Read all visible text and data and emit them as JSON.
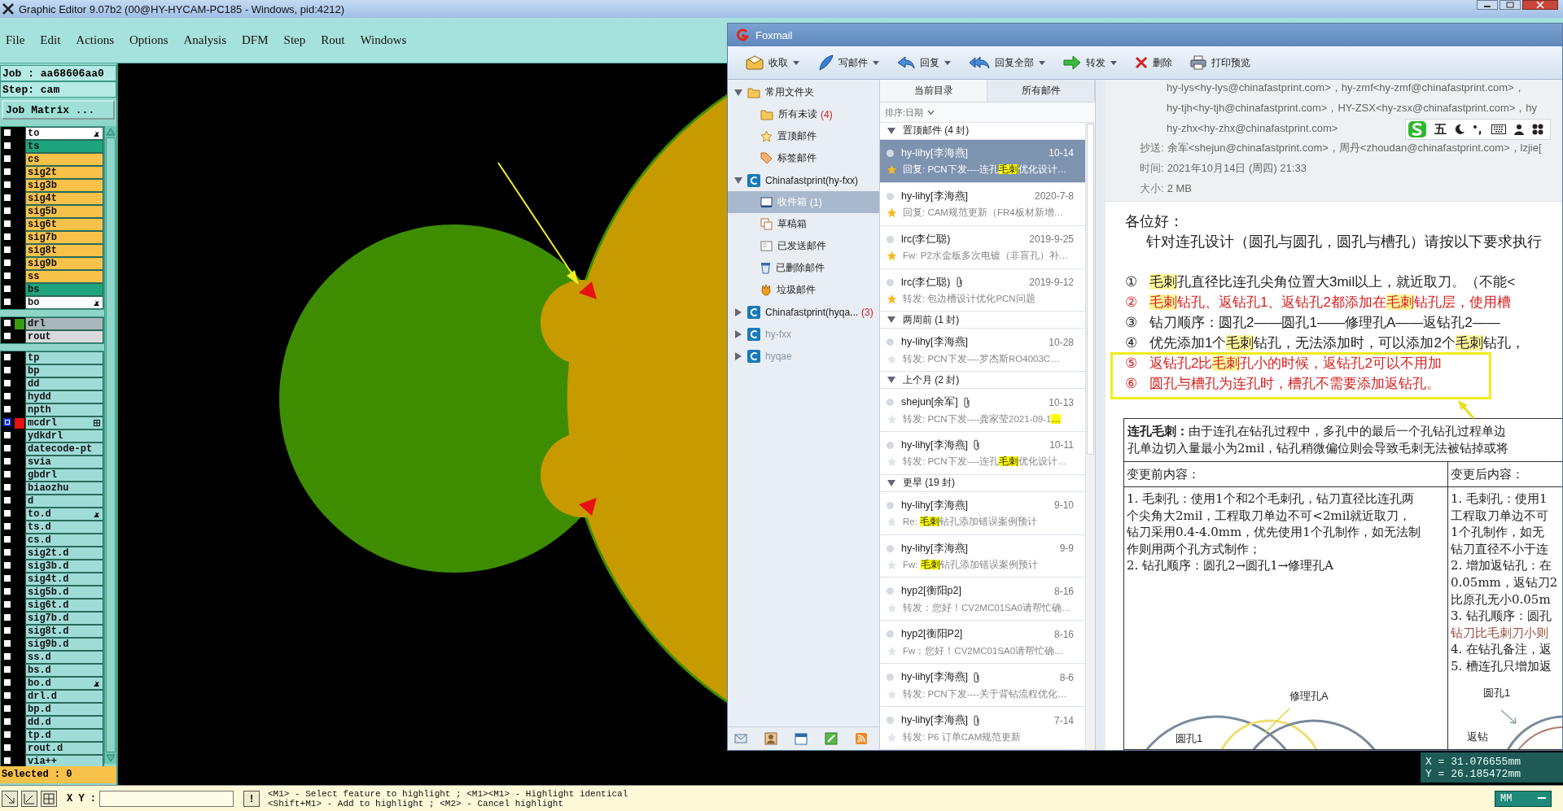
{
  "editor": {
    "title": "Graphic Editor 9.07b2 (00@HY-HYCAM-PC185 - Windows, pid:4212)",
    "menu": [
      "File",
      "Edit",
      "Actions",
      "Options",
      "Analysis",
      "DFM",
      "Step",
      "Rout",
      "Windows"
    ],
    "job": "Job : aa68606aa0",
    "step": "Step: cam",
    "job_matrix_button": "Job Matrix ...",
    "layer_groups": [
      [
        {
          "name": "to",
          "color": "#ffffff",
          "marker": {
            "kind": "hand"
          },
          "selected": false
        },
        {
          "name": "ts",
          "color": "#1fa37c",
          "selected": false
        },
        {
          "name": "cs",
          "color": "#f8c24a",
          "selected": false
        },
        {
          "name": "sig2t",
          "color": "#f8c24a",
          "selected": false
        },
        {
          "name": "sig3b",
          "color": "#f8c24a",
          "selected": false
        },
        {
          "name": "sig4t",
          "color": "#f8c24a",
          "selected": false
        },
        {
          "name": "sig5b",
          "color": "#f8c24a",
          "selected": false
        },
        {
          "name": "sig6t",
          "color": "#f8c24a",
          "selected": false
        },
        {
          "name": "sig7b",
          "color": "#f8c24a",
          "selected": false
        },
        {
          "name": "sig8t",
          "color": "#f8c24a",
          "selected": false
        },
        {
          "name": "sig9b",
          "color": "#f8c24a",
          "selected": false
        },
        {
          "name": "ss",
          "color": "#f8c24a",
          "selected": false
        },
        {
          "name": "bs",
          "color": "#1fa37c",
          "selected": false
        },
        {
          "name": "bo",
          "color": "#ffffff",
          "marker": {
            "kind": "hand"
          },
          "selected": false
        }
      ],
      [
        {
          "name": "drl",
          "color": "#a9b6ba",
          "swatch": {
            "color": "#3c9a10"
          },
          "selected": false
        },
        {
          "name": "rout",
          "color": "#dadada",
          "selected": false
        }
      ],
      [
        {
          "name": "tp",
          "color": "#9fdcd8",
          "selected": false
        },
        {
          "name": "bp",
          "color": "#9fdcd8",
          "selected": false
        },
        {
          "name": "dd",
          "color": "#9fdcd8",
          "selected": false
        },
        {
          "name": "hydd",
          "color": "#9fdcd8",
          "selected": false
        },
        {
          "name": "npth",
          "color": "#9fdcd8",
          "selected": false
        },
        {
          "name": "mcdrl",
          "color": "#9fdcd8",
          "swatch": {
            "color": "#e81010"
          },
          "marker": {
            "kind": "grid"
          },
          "selected": true
        },
        {
          "name": "ydkdrl",
          "color": "#9fdcd8",
          "selected": false
        },
        {
          "name": "datecode-pt",
          "color": "#9fdcd8",
          "selected": false
        },
        {
          "name": "svia",
          "color": "#9fdcd8",
          "selected": false
        },
        {
          "name": "gbdrl",
          "color": "#9fdcd8",
          "selected": false
        },
        {
          "name": "biaozhu",
          "color": "#9fdcd8",
          "selected": false
        },
        {
          "name": "d",
          "color": "#9fdcd8",
          "selected": false
        },
        {
          "name": "to.d",
          "color": "#9fdcd8",
          "marker": {
            "kind": "hand"
          },
          "selected": false
        },
        {
          "name": "ts.d",
          "color": "#9fdcd8",
          "selected": false
        },
        {
          "name": "cs.d",
          "color": "#9fdcd8",
          "selected": false
        },
        {
          "name": "sig2t.d",
          "color": "#9fdcd8",
          "selected": false
        },
        {
          "name": "sig3b.d",
          "color": "#9fdcd8",
          "selected": false
        },
        {
          "name": "sig4t.d",
          "color": "#9fdcd8",
          "selected": false
        },
        {
          "name": "sig5b.d",
          "color": "#9fdcd8",
          "selected": false
        },
        {
          "name": "sig6t.d",
          "color": "#9fdcd8",
          "selected": false
        },
        {
          "name": "sig7b.d",
          "color": "#9fdcd8",
          "selected": false
        },
        {
          "name": "sig8t.d",
          "color": "#9fdcd8",
          "selected": false
        },
        {
          "name": "sig9b.d",
          "color": "#9fdcd8",
          "selected": false
        },
        {
          "name": "ss.d",
          "color": "#9fdcd8",
          "selected": false
        },
        {
          "name": "bs.d",
          "color": "#9fdcd8",
          "selected": false
        },
        {
          "name": "bo.d",
          "color": "#9fdcd8",
          "marker": {
            "kind": "hand"
          },
          "selected": false
        },
        {
          "name": "drl.d",
          "color": "#9fdcd8",
          "selected": false
        },
        {
          "name": "bp.d",
          "color": "#9fdcd8",
          "selected": false
        },
        {
          "name": "dd.d",
          "color": "#9fdcd8",
          "selected": false
        },
        {
          "name": "tp.d",
          "color": "#9fdcd8",
          "selected": false
        },
        {
          "name": "rout.d",
          "color": "#9fdcd8",
          "selected": false
        },
        {
          "name": "via++",
          "color": "#9fdcd8",
          "selected": false
        }
      ]
    ],
    "selected_count": "Selected : 0",
    "coordinates": [
      "X = 31.076655mm",
      "Y = 26.185472mm"
    ],
    "xy_label": "X Y :",
    "exclaim_button": "!",
    "hint_lines": [
      "<M1> - Select feature to highlight ; <M1><M1> - Highlight identical",
      "<Shift+M1> - Add to highlight ; <M2> - Cancel highlight"
    ],
    "units": "MM"
  },
  "foxmail": {
    "title": "Foxmail",
    "toolbar": [
      {
        "label": "收取",
        "kind": "receive",
        "dropdown": true
      },
      {
        "label": "写邮件",
        "kind": "compose",
        "dropdown": true
      },
      {
        "label": "回复",
        "kind": "reply",
        "dropdown": true
      },
      {
        "label": "回复全部",
        "kind": "reply_all",
        "dropdown": true
      },
      {
        "label": "转发",
        "kind": "forward",
        "dropdown": true
      },
      {
        "label": "删除",
        "kind": "delete",
        "dropdown": false
      },
      {
        "label": "打印预览",
        "kind": "print",
        "dropdown": false
      }
    ],
    "folders": [
      {
        "label": "常用文件夹",
        "kind": "folder",
        "expanded": true,
        "selected": false,
        "disabled": false,
        "children": [
          {
            "label": "所有未读",
            "kind": "folder",
            "count": "(4)",
            "selected": false,
            "disabled": false
          },
          {
            "label": "置顶邮件",
            "kind": "star",
            "selected": false,
            "disabled": false
          },
          {
            "label": "标签邮件",
            "kind": "tag",
            "selected": false,
            "disabled": false
          }
        ]
      },
      {
        "label": "Chinafastprint(hy-fxx)",
        "kind": "account",
        "expanded": true,
        "selected": false,
        "disabled": false,
        "children": [
          {
            "label": "收件箱",
            "kind": "inbox",
            "count": "(1)",
            "selected": true,
            "disabled": false
          },
          {
            "label": "草稿箱",
            "kind": "drafts",
            "selected": false,
            "disabled": false
          },
          {
            "label": "已发送邮件",
            "kind": "sent",
            "selected": false,
            "disabled": false
          },
          {
            "label": "已删除邮件",
            "kind": "deleted",
            "selected": false,
            "disabled": false
          },
          {
            "label": "垃圾邮件",
            "kind": "junk",
            "selected": false,
            "disabled": false
          }
        ]
      },
      {
        "label": "Chinafastprint(hyqa...",
        "kind": "account",
        "count": "(3)",
        "expanded": false,
        "selected": false,
        "disabled": false
      },
      {
        "label": "hy-fxx",
        "kind": "account",
        "expanded": false,
        "selected": false,
        "disabled": true
      },
      {
        "label": "hyqae",
        "kind": "account",
        "expanded": false,
        "selected": false,
        "disabled": true
      }
    ],
    "list_tabs": [
      {
        "label": "当前目录",
        "selected": true
      },
      {
        "label": "所有邮件",
        "selected": false
      }
    ],
    "sort": "排序:日期",
    "mail_groups": [
      {
        "title": "置顶邮件 (4 封)",
        "expanded": true,
        "items": [
          {
            "sender": "hy-lihy[李海燕]",
            "date": "10-14",
            "attachment": false,
            "starred": true,
            "selected": true,
            "subject": [
              {
                "text": "回复: PCN下发----连孔",
                "highlight": false
              },
              {
                "text": "毛刺",
                "highlight": true
              },
              {
                "text": "优化设计…",
                "highlight": false
              }
            ]
          },
          {
            "sender": "hy-lihy[李海燕]",
            "date": "2020-7-8",
            "attachment": false,
            "starred": true,
            "selected": false,
            "subject": [
              {
                "text": "回复: CAM规范更新（FR4板材新增…",
                "highlight": false
              }
            ]
          },
          {
            "sender": "lrc(李仁聪)",
            "date": "2019-9-25",
            "attachment": false,
            "starred": true,
            "selected": false,
            "subject": [
              {
                "text": "Fw: P2水金板多次电镀（非盲孔）补…",
                "highlight": false
              }
            ]
          },
          {
            "sender": "lrc(李仁聪)",
            "date": "2019-9-12",
            "attachment": true,
            "starred": true,
            "selected": false,
            "subject": [
              {
                "text": "转发: 包边槽设计优化PCN问题",
                "highlight": false
              }
            ]
          }
        ]
      },
      {
        "title": "两周前 (1 封)",
        "expanded": true,
        "items": [
          {
            "sender": "hy-lihy[李海燕]",
            "date": "10-28",
            "attachment": false,
            "starred": false,
            "selected": false,
            "subject": [
              {
                "text": "转发: PCN下发----罗杰斯RO4003C…",
                "highlight": false
              }
            ]
          }
        ]
      },
      {
        "title": "上个月 (2 封)",
        "expanded": true,
        "items": [
          {
            "sender": "shejun[余军]",
            "date": "10-13",
            "attachment": true,
            "starred": false,
            "selected": false,
            "subject": [
              {
                "text": "转发: PCN下发----龚家莹2021-09-1",
                "highlight": false
              },
              {
                "text": "…",
                "highlight": true
              }
            ]
          },
          {
            "sender": "hy-lihy[李海燕]",
            "date": "10-11",
            "attachment": true,
            "starred": false,
            "selected": false,
            "subject": [
              {
                "text": "转发: PCN下发----连孔",
                "highlight": false
              },
              {
                "text": "毛刺",
                "highlight": true
              },
              {
                "text": "优化设计…",
                "highlight": false
              }
            ]
          }
        ]
      },
      {
        "title": "更早 (19 封)",
        "expanded": true,
        "items": [
          {
            "sender": "hy-lihy[李海燕]",
            "date": "9-10",
            "attachment": false,
            "starred": false,
            "selected": false,
            "subject": [
              {
                "text": "Re: ",
                "highlight": false
              },
              {
                "text": "毛刺",
                "highlight": true
              },
              {
                "text": "钻孔添加错误案例预计",
                "highlight": false
              }
            ]
          },
          {
            "sender": "hy-lihy[李海燕]",
            "date": "9-9",
            "attachment": false,
            "starred": false,
            "selected": false,
            "subject": [
              {
                "text": "Fw: ",
                "highlight": false
              },
              {
                "text": "毛刺",
                "highlight": true
              },
              {
                "text": "钻孔添加错误案例预计",
                "highlight": false
              }
            ]
          },
          {
            "sender": "hyp2[衡阳p2]",
            "date": "8-16",
            "attachment": false,
            "starred": false,
            "selected": false,
            "subject": [
              {
                "text": "转发：您好！CV2MC01SA0请帮忙确…",
                "highlight": false
              }
            ]
          },
          {
            "sender": "hyp2[衡阳P2]",
            "date": "8-16",
            "attachment": false,
            "starred": false,
            "selected": false,
            "subject": [
              {
                "text": "Fw：您好！CV2MC01SA0请帮忙确…",
                "highlight": false
              }
            ]
          },
          {
            "sender": "hy-lihy[李海燕]",
            "date": "8-6",
            "attachment": true,
            "starred": false,
            "selected": false,
            "subject": [
              {
                "text": "转发: PCN下发----关于背钻流程优化…",
                "highlight": false
              }
            ]
          },
          {
            "sender": "hy-lihy[李海燕]",
            "date": "7-14",
            "attachment": true,
            "starred": false,
            "selected": false,
            "subject": [
              {
                "text": "转发:  P6 订单CAM规范更新",
                "highlight": false
              }
            ]
          }
        ]
      }
    ],
    "message": {
      "recipient_lines": [
        "hy-lys<hy-lys@chinafastprint.com>，hy-zmf<hy-zmf@chinafastprint.com>，",
        "hy-tjh<hy-tjh@chinafastprint.com>，HY-ZSX<hy-zsx@chinafastprint.com>，hy",
        "hy-zhx<hy-zhx@chinafastprint.com>"
      ],
      "fields": [
        {
          "label": "抄送:",
          "value": "余军<shejun@chinafastprint.com>，周丹<zhoudan@chinafastprint.com>，lzjie["
        },
        {
          "label": "时间:",
          "value": "2021年10月14日 (周四) 21:33"
        },
        {
          "label": "大小:",
          "value": "2 MB"
        }
      ],
      "greeting": "各位好：",
      "intro": "针对连孔设计（圆孔与圆孔，圆孔与槽孔）请按以下要求执行",
      "requirements": [
        {
          "number": "①",
          "color": "#222222",
          "segments": [
            {
              "text": "毛刺",
              "highlight": true
            },
            {
              "text": "孔直径比连孔尖角位置大3mil以上，就近取刀。（不能<",
              "highlight": false
            }
          ]
        },
        {
          "number": "②",
          "color": "#d42020",
          "segments": [
            {
              "text": "毛刺",
              "highlight": true
            },
            {
              "text": "钻孔、返钻孔1、返钻孔2都添加在",
              "highlight": false
            },
            {
              "text": "毛刺",
              "highlight": true
            },
            {
              "text": "钻孔层，使用槽",
              "highlight": false
            }
          ]
        },
        {
          "number": "③",
          "color": "#222222",
          "segments": [
            {
              "text": "钻刀顺序：圆孔2——圆孔1——修理孔A——返钻孔2——",
              "highlight": false
            }
          ]
        },
        {
          "number": "④",
          "color": "#222222",
          "segments": [
            {
              "text": "优先添加1个",
              "highlight": false
            },
            {
              "text": "毛刺",
              "highlight": true
            },
            {
              "text": "钻孔，无法添加时，可以添加2个",
              "highlight": false
            },
            {
              "text": "毛刺",
              "highlight": true
            },
            {
              "text": "钻孔，",
              "highlight": false
            }
          ]
        },
        {
          "number": "⑤",
          "color": "#d42020",
          "segments": [
            {
              "text": "返钻孔2比",
              "highlight": false
            },
            {
              "text": "毛刺",
              "highlight": true
            },
            {
              "text": "孔小的时候，返钻孔2可以不用加",
              "highlight": false
            }
          ]
        },
        {
          "number": "⑥",
          "color": "#d42020",
          "segments": [
            {
              "text": "圆孔与槽孔为连孔时，槽孔不需要添加返钻孔。",
              "highlight": false
            }
          ]
        }
      ],
      "table": {
        "summary_lines": [
          "**连孔毛刺：**由于连孔在钻孔过程中，多孔中的最后一个孔钻孔过程单边",
          "孔单边切入量最小为2mil，钻孔稍微偏位则会导致毛刺无法被钻掉或将"
        ],
        "before_heading": "变更前内容：",
        "after_heading": "变更后内容：",
        "before_lines": [
          {
            "text": "1. 毛刺孔：使用1个和2个毛刺孔，钻刀直径比连孔两",
            "color": "#222222"
          },
          {
            "text": "个尖角大2mil，工程取刀单边不可<2mil就近取刀，",
            "color": "#222222"
          },
          {
            "text": "钻刀采用0.4-4.0mm，优先使用1个孔制作，如无法制",
            "color": "#222222"
          },
          {
            "text": "作则用两个孔方式制作；",
            "color": "#222222"
          },
          {
            "text": "2. 钻孔顺序：圆孔2→圆孔1→修理孔A",
            "color": "#222222"
          }
        ],
        "after_lines": [
          {
            "text": "1. 毛刺孔：使用1",
            "color": "#222222"
          },
          {
            "text": "工程取刀单边不可",
            "color": "#222222"
          },
          {
            "text": "1个孔制作，如无",
            "color": "#222222"
          },
          {
            "text": "钻刀直径不小于连",
            "color": "#222222"
          },
          {
            "text": "2. 增加返钻孔：在",
            "color": "#222222"
          },
          {
            "text": "0.05mm，返钻刀2",
            "color": "#222222"
          },
          {
            "text": "比原孔无小0.05m",
            "color": "#222222"
          },
          {
            "text": "3. 钻孔顺序：圆孔",
            "color": "#222222"
          },
          {
            "text": "钻刀比毛刺刀小则",
            "color": "#9a4a3a"
          },
          {
            "text": "4. 在钻孔备注，返",
            "color": "#222222"
          },
          {
            "text": "5. 槽连孔只增加返",
            "color": "#222222"
          }
        ],
        "before_diagram_labels": [
          "修理孔A",
          "圆孔1"
        ],
        "after_diagram_labels": [
          "圆孔1",
          "返钻"
        ]
      }
    },
    "ime_bar": {
      "mode": "五"
    }
  }
}
